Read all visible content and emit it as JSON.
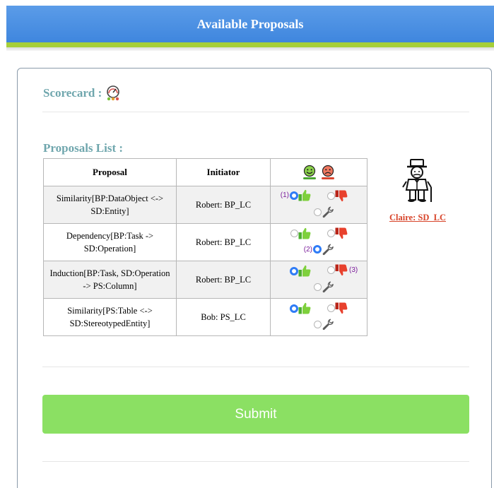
{
  "header": {
    "title": "Available Proposals"
  },
  "scorecard": {
    "label": "Scorecard :",
    "icon": "gauge-icon"
  },
  "proposals": {
    "title": "Proposals List :",
    "columns": {
      "proposal": "Proposal",
      "initiator": "Initiator"
    },
    "vote_header_icons": [
      "smiley-happy-icon",
      "smiley-sad-icon"
    ],
    "rows": [
      {
        "proposal_line1": "Similarity[BP:DataObject <->",
        "proposal_line2": "SD:Entity]",
        "initiator": "Robert: BP_LC",
        "selected": "accept",
        "accept_tag": "(1)",
        "wrench_tag": "",
        "reject_tag": ""
      },
      {
        "proposal_line1": "Dependency[BP:Task ->",
        "proposal_line2": "SD:Operation]",
        "initiator": "Robert: BP_LC",
        "selected": "modify",
        "accept_tag": "",
        "wrench_tag": "(2)",
        "reject_tag": ""
      },
      {
        "proposal_line1": "Induction[BP:Task, SD:Operation",
        "proposal_line2": "-> PS:Column]",
        "initiator": "Robert: BP_LC",
        "selected": "accept",
        "accept_tag": "",
        "wrench_tag": "",
        "reject_tag": "(3)"
      },
      {
        "proposal_line1": "Similarity[PS:Table <->",
        "proposal_line2": "SD:StereotypedEntity]",
        "initiator": "Bob: PS_LC",
        "selected": "accept",
        "accept_tag": "",
        "wrench_tag": "",
        "reject_tag": ""
      }
    ]
  },
  "user": {
    "name": "Claire: SD_LC",
    "icon": "gentleman-character-icon"
  },
  "submit": {
    "label": "Submit"
  },
  "colors": {
    "header": "#4a90e2",
    "header_stripe": "#a6cf39",
    "section_title": "#6fa6ad",
    "submit": "#8be063",
    "link": "#d8452b",
    "tag": "#7a1c9a",
    "radio_checked": "#2f7cf6"
  }
}
